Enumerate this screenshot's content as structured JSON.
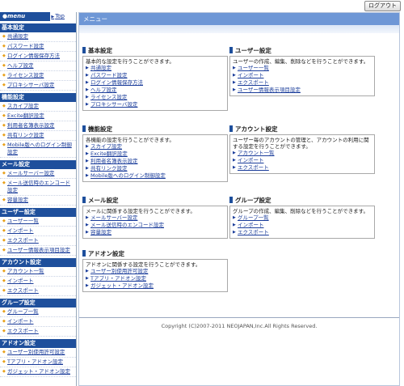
{
  "header": {
    "logout_label": "ログアウト"
  },
  "sidebar": {
    "menu_label": "menu",
    "top_label": "Top",
    "sections": [
      {
        "title": "基本設定",
        "items": [
          "共通設定",
          "パスワード設定",
          "ログイン情報保存方法",
          "ヘルプ設定",
          "ライセンス設定",
          "プロキシサーバ設定"
        ]
      },
      {
        "title": "機能設定",
        "items": [
          "スカイプ設定",
          "Excite翻訳設定",
          "利用者名簿表示設定",
          "共有リンク設定",
          "Mobile版へのログイン制御設定"
        ]
      },
      {
        "title": "メール設定",
        "items": [
          "メールサーバー設定",
          "メール送信時のエンコード設定",
          "容量設定"
        ]
      },
      {
        "title": "ユーザー設定",
        "items": [
          "ユーザー一覧",
          "インポート",
          "エクスポート",
          "ユーザー情報表示項目設定"
        ]
      },
      {
        "title": "アカウント設定",
        "items": [
          "アカウント一覧",
          "インポート",
          "エクスポート"
        ]
      },
      {
        "title": "グループ設定",
        "items": [
          "グループ一覧",
          "インポート",
          "エクスポート"
        ]
      },
      {
        "title": "アドオン設定",
        "items": [
          "ユーザー別使用許可設定",
          "Tアプリ・アドオン設定",
          "ガジェット・アドオン設定"
        ]
      }
    ]
  },
  "main": {
    "title": "メニュー",
    "panels": [
      {
        "title": "基本設定",
        "desc": "基本的な設定を行うことができます。",
        "links": [
          "共通設定",
          "パスワード設定",
          "ログイン情報保存方法",
          "ヘルプ設定",
          "ライセンス設定",
          "プロキシサーバ設定"
        ]
      },
      {
        "title": "ユーザー設定",
        "desc": "ユーザーの作成、編集、削除などを行うことができます。",
        "links": [
          "ユーザー一覧",
          "インポート",
          "エクスポート",
          "ユーザー情報表示項目設定"
        ]
      },
      {
        "title": "機能設定",
        "desc": "各機能の設定を行うことができます。",
        "links": [
          "スカイプ設定",
          "Excite翻訳設定",
          "利用者名簿表示設定",
          "共有リンク設定",
          "Mobile版へのログイン制御設定"
        ]
      },
      {
        "title": "アカウント設定",
        "desc": "ユーザー毎のアカウントの管理と、アカウントの利用に関する設定を行うことができます。",
        "links": [
          "アカウント一覧",
          "インポート",
          "エクスポート"
        ]
      },
      {
        "title": "メール設定",
        "desc": "メールに関係する設定を行うことができます。",
        "links": [
          "メールサーバー設定",
          "メール送信時のエンコード設定",
          "容量設定"
        ]
      },
      {
        "title": "グループ設定",
        "desc": "グループの作成、編集、削除などを行うことができます。",
        "links": [
          "グループ一覧",
          "インポート",
          "エクスポート"
        ]
      },
      {
        "title": "アドオン設定",
        "desc": "アドオンに関係する設定を行うことができます。",
        "links": [
          "ユーザー別使用許可設定",
          "Tアプリ・アドオン設定",
          "ガジェット・アドオン設定"
        ]
      }
    ],
    "footer": "Copyright (C)2007-2011 NEOJAPAN,Inc.All Rights Reserved."
  }
}
